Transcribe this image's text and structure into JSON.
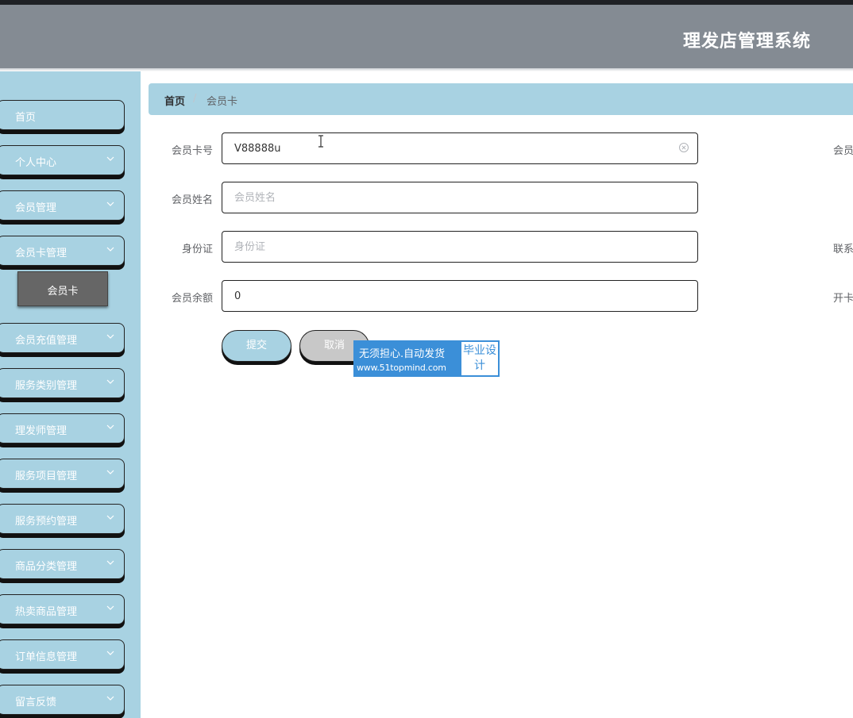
{
  "header": {
    "title": "理发店管理系统"
  },
  "sidebar": {
    "items": [
      {
        "label": "首页"
      },
      {
        "label": "个人中心"
      },
      {
        "label": "会员管理"
      },
      {
        "label": "会员卡管理"
      },
      {
        "label": "会员充值管理"
      },
      {
        "label": "服务类别管理"
      },
      {
        "label": "理发师管理"
      },
      {
        "label": "服务项目管理"
      },
      {
        "label": "服务预约管理"
      },
      {
        "label": "商品分类管理"
      },
      {
        "label": "热卖商品管理"
      },
      {
        "label": "订单信息管理"
      },
      {
        "label": "留言反馈"
      }
    ],
    "submenu": {
      "label": "会员卡"
    }
  },
  "breadcrumb": {
    "home": "首页",
    "separator": "/",
    "current": "会员卡"
  },
  "form": {
    "card_no": {
      "label": "会员卡号",
      "value": "V88888u"
    },
    "name": {
      "label": "会员姓名",
      "placeholder": "会员姓名"
    },
    "id_card": {
      "label": "身份证",
      "placeholder": "身份证"
    },
    "balance": {
      "label": "会员余额",
      "value": "0"
    },
    "right_labels": [
      "会员",
      "联系",
      "开卡"
    ],
    "submit_label": "提交",
    "cancel_label": "取消"
  },
  "watermark": {
    "line1": "无须担心.自动发货",
    "line2": "www.51topmind.com",
    "badge": "毕业设计"
  },
  "colors": {
    "header": "#848b93",
    "sidebar": "#a8d2e2",
    "accent": "#a8d2e2",
    "submenu": "#666666"
  }
}
